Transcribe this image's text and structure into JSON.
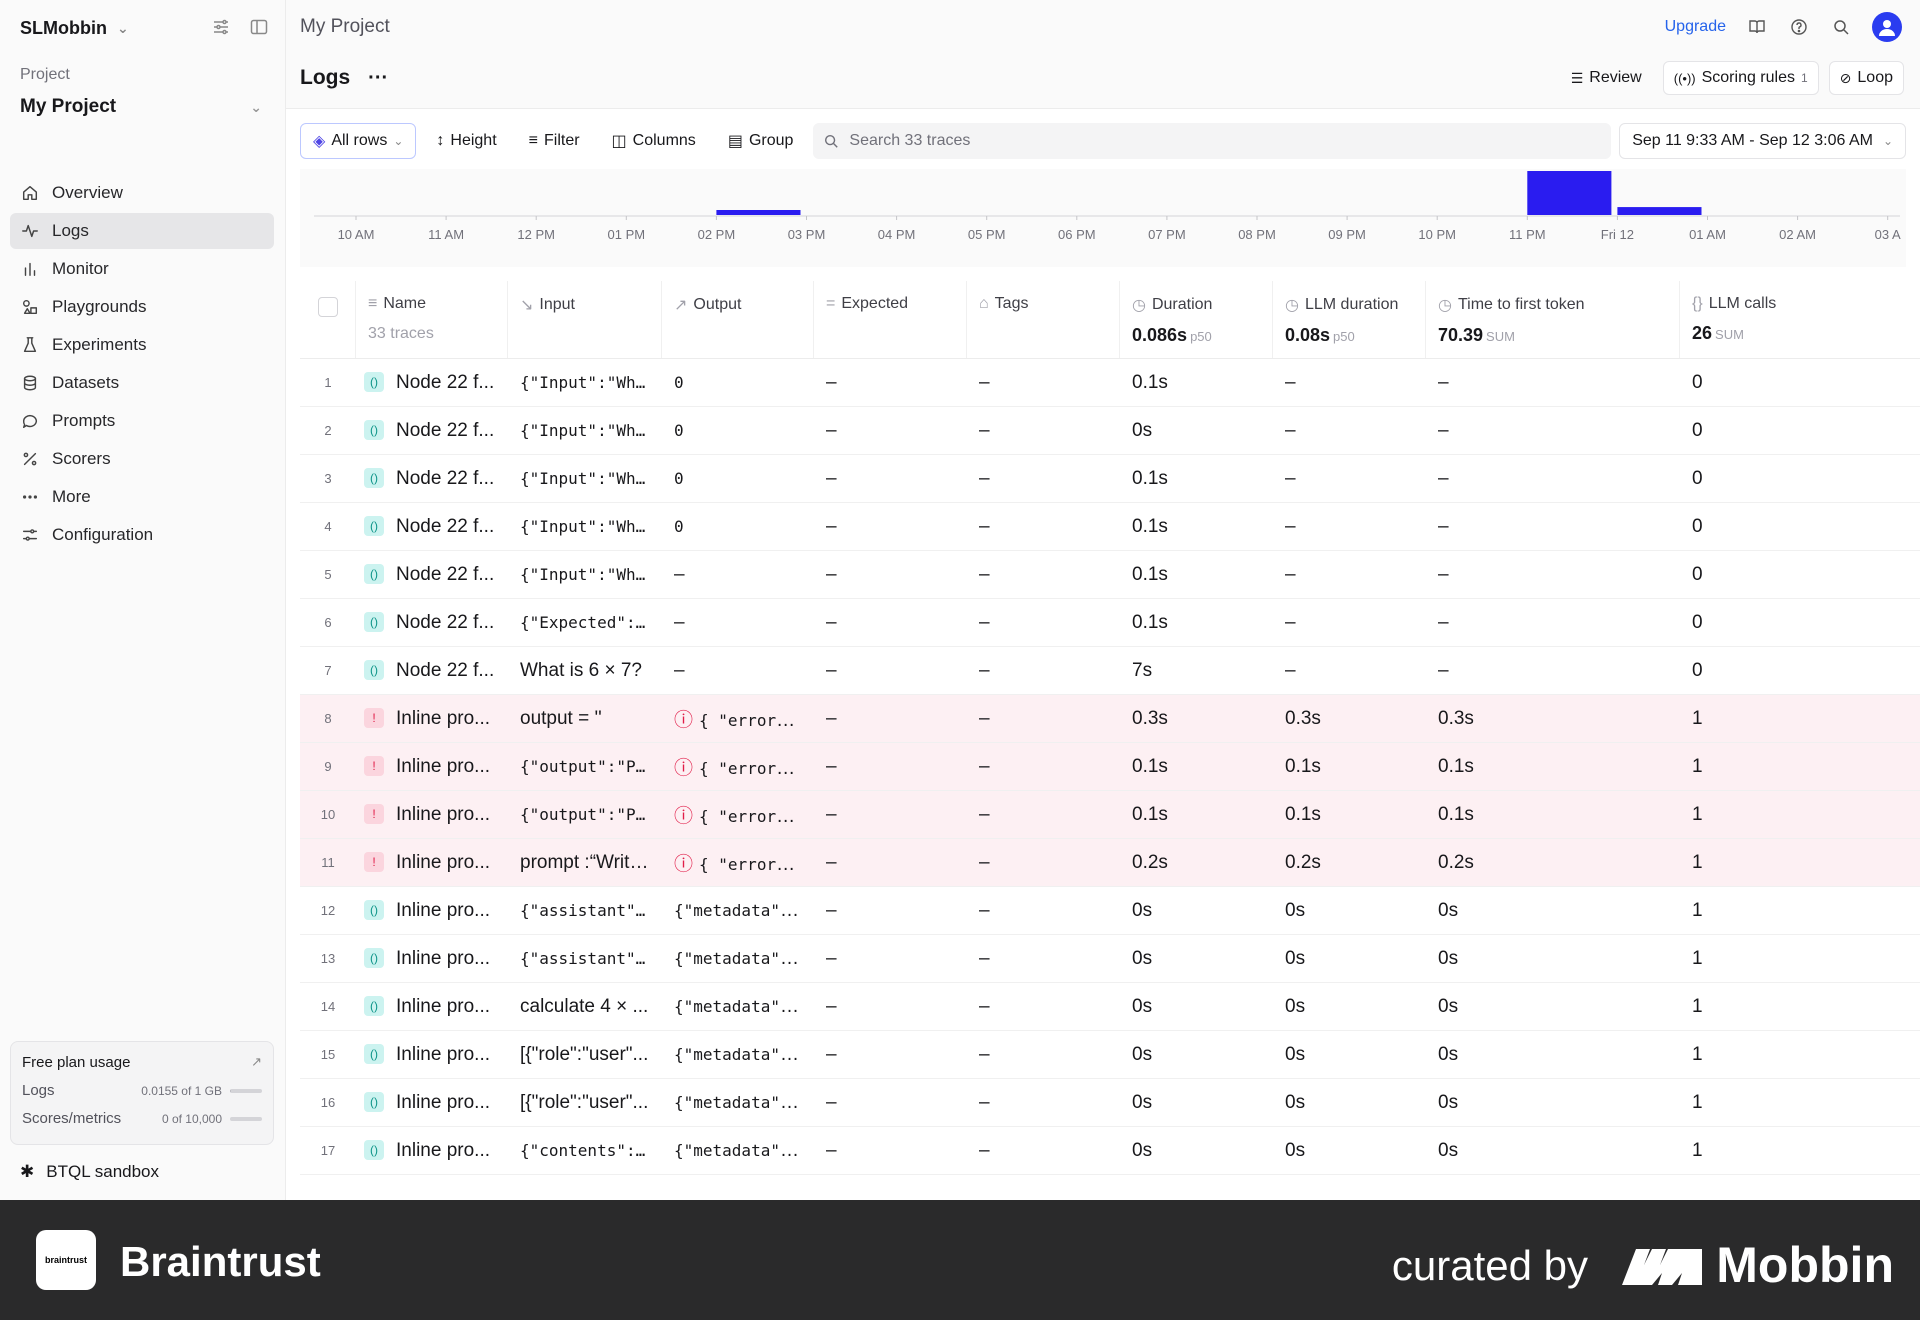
{
  "workspace": {
    "name": "SLMobbin"
  },
  "sidebar": {
    "project_label": "Project",
    "project_name": "My Project",
    "items": [
      {
        "label": "Overview",
        "icon": "home-icon",
        "active": false
      },
      {
        "label": "Logs",
        "icon": "activity-icon",
        "active": true
      },
      {
        "label": "Monitor",
        "icon": "bar-chart-icon",
        "active": false
      },
      {
        "label": "Playgrounds",
        "icon": "shapes-icon",
        "active": false
      },
      {
        "label": "Experiments",
        "icon": "flask-icon",
        "active": false
      },
      {
        "label": "Datasets",
        "icon": "database-icon",
        "active": false
      },
      {
        "label": "Prompts",
        "icon": "message-icon",
        "active": false
      },
      {
        "label": "Scorers",
        "icon": "percent-icon",
        "active": false
      },
      {
        "label": "More",
        "icon": "more-horizontal-icon",
        "active": false
      },
      {
        "label": "Configuration",
        "icon": "sliders-icon",
        "active": false
      }
    ],
    "usage": {
      "title": "Free plan usage",
      "logs_label": "Logs",
      "logs_value": "0.0155 of 1 GB",
      "logs_fraction": 0.0155,
      "scores_label": "Scores/metrics",
      "scores_value": "0 of 10,000",
      "scores_fraction": 0
    },
    "btql": "BTQL sandbox"
  },
  "topbar": {
    "breadcrumb": "My Project",
    "upgrade": "Upgrade"
  },
  "header": {
    "title": "Logs",
    "review": "Review",
    "scoring_rules": "Scoring rules",
    "scoring_rules_count": "1",
    "loop": "Loop"
  },
  "toolbar": {
    "all_rows": "All rows",
    "height": "Height",
    "filter": "Filter",
    "columns": "Columns",
    "group": "Group",
    "search_placeholder": "Search 33 traces",
    "date_range": "Sep 11 9:33 AM - Sep 12 3:06 AM"
  },
  "histogram": {
    "ticks": [
      "10 AM",
      "11 AM",
      "12 PM",
      "01 PM",
      "02 PM",
      "03 PM",
      "04 PM",
      "05 PM",
      "06 PM",
      "07 PM",
      "08 PM",
      "09 PM",
      "10 PM",
      "11 PM",
      "Fri 12",
      "01 AM",
      "02 AM",
      "03 A"
    ],
    "bars": [
      {
        "from_tick": 4,
        "to_tick": 5,
        "level": 0.1
      },
      {
        "from_tick": 13,
        "to_tick": 14,
        "level": 1.0
      },
      {
        "from_tick": 14,
        "to_tick": 15,
        "level": 0.18
      }
    ],
    "bar_color": "#2a1cf0"
  },
  "table": {
    "columns": {
      "name": "Name",
      "name_sub": "33 traces",
      "input": "Input",
      "output": "Output",
      "expected": "Expected",
      "tags": "Tags",
      "duration": "Duration",
      "duration_stat": "0.086s",
      "duration_unit": "p50",
      "llm_duration": "LLM duration",
      "llm_duration_stat": "0.08s",
      "llm_duration_unit": "p50",
      "ttft": "Time to first token",
      "ttft_stat": "70.39",
      "ttft_unit": "SUM",
      "llm_calls": "LLM calls",
      "llm_calls_stat": "26",
      "llm_calls_unit": "SUM"
    },
    "rows": [
      {
        "n": "1",
        "name": "Node 22 f...",
        "input": "{\"Input\":\"Wha...",
        "input_mono": true,
        "output": "0",
        "output_mono": true,
        "expected": "–",
        "tags": "–",
        "duration": "0.1s",
        "llm": "–",
        "ttft": "–",
        "calls": "0",
        "error": false
      },
      {
        "n": "2",
        "name": "Node 22 f...",
        "input": "{\"Input\":\"Wha...",
        "input_mono": true,
        "output": "0",
        "output_mono": true,
        "expected": "–",
        "tags": "–",
        "duration": "0s",
        "llm": "–",
        "ttft": "–",
        "calls": "0",
        "error": false
      },
      {
        "n": "3",
        "name": "Node 22 f...",
        "input": "{\"Input\":\"Wha...",
        "input_mono": true,
        "output": "0",
        "output_mono": true,
        "expected": "–",
        "tags": "–",
        "duration": "0.1s",
        "llm": "–",
        "ttft": "–",
        "calls": "0",
        "error": false
      },
      {
        "n": "4",
        "name": "Node 22 f...",
        "input": "{\"Input\":\"Wha...",
        "input_mono": true,
        "output": "0",
        "output_mono": true,
        "expected": "–",
        "tags": "–",
        "duration": "0.1s",
        "llm": "–",
        "ttft": "–",
        "calls": "0",
        "error": false
      },
      {
        "n": "5",
        "name": "Node 22 f...",
        "input": "{\"Input\":\"Wha...",
        "input_mono": true,
        "output": "–",
        "output_mono": false,
        "expected": "–",
        "tags": "–",
        "duration": "0.1s",
        "llm": "–",
        "ttft": "–",
        "calls": "0",
        "error": false
      },
      {
        "n": "6",
        "name": "Node 22 f...",
        "input": "{\"Expected\":4...",
        "input_mono": true,
        "output": "–",
        "output_mono": false,
        "expected": "–",
        "tags": "–",
        "duration": "0.1s",
        "llm": "–",
        "ttft": "–",
        "calls": "0",
        "error": false
      },
      {
        "n": "7",
        "name": "Node 22 f...",
        "input": "What is 6 × 7?",
        "input_mono": false,
        "output": "–",
        "output_mono": false,
        "expected": "–",
        "tags": "–",
        "duration": "7s",
        "llm": "–",
        "ttft": "–",
        "calls": "0",
        "error": false
      },
      {
        "n": "8",
        "name": "Inline pro...",
        "input": "output = ''",
        "input_mono": false,
        "output": "{ \"error\":...",
        "output_mono": true,
        "expected": "–",
        "tags": "–",
        "duration": "0.3s",
        "llm": "0.3s",
        "ttft": "0.3s",
        "calls": "1",
        "error": true
      },
      {
        "n": "9",
        "name": "Inline pro...",
        "input": "{\"output\":\"Po...",
        "input_mono": true,
        "output": "{ \"error\":...",
        "output_mono": true,
        "expected": "–",
        "tags": "–",
        "duration": "0.1s",
        "llm": "0.1s",
        "ttft": "0.1s",
        "calls": "1",
        "error": true
      },
      {
        "n": "10",
        "name": "Inline pro...",
        "input": "{\"output\":\"Po...",
        "input_mono": true,
        "output": "{ \"error\":...",
        "output_mono": true,
        "expected": "–",
        "tags": "–",
        "duration": "0.1s",
        "llm": "0.1s",
        "ttft": "0.1s",
        "calls": "1",
        "error": true
      },
      {
        "n": "11",
        "name": "Inline pro...",
        "input": "prompt :“Write...",
        "input_mono": false,
        "output": "{ \"error\":...",
        "output_mono": true,
        "expected": "–",
        "tags": "–",
        "duration": "0.2s",
        "llm": "0.2s",
        "ttft": "0.2s",
        "calls": "1",
        "error": true
      },
      {
        "n": "12",
        "name": "Inline pro...",
        "input": "{\"assistant\":...",
        "input_mono": true,
        "output": "{\"metadata\":{...",
        "output_mono": true,
        "expected": "–",
        "tags": "–",
        "duration": "0s",
        "llm": "0s",
        "ttft": "0s",
        "calls": "1",
        "error": false
      },
      {
        "n": "13",
        "name": "Inline pro...",
        "input": "{\"assistant\":...",
        "input_mono": true,
        "output": "{\"metadata\":{...",
        "output_mono": true,
        "expected": "–",
        "tags": "–",
        "duration": "0s",
        "llm": "0s",
        "ttft": "0s",
        "calls": "1",
        "error": false
      },
      {
        "n": "14",
        "name": "Inline pro...",
        "input": "calculate 4 × ...",
        "input_mono": false,
        "output": "{\"metadata\":{...",
        "output_mono": true,
        "expected": "–",
        "tags": "–",
        "duration": "0s",
        "llm": "0s",
        "ttft": "0s",
        "calls": "1",
        "error": false
      },
      {
        "n": "15",
        "name": "Inline pro...",
        "input": "[{\"role\":\"user\"...",
        "input_mono": false,
        "output": "{\"metadata\":{...",
        "output_mono": true,
        "expected": "–",
        "tags": "–",
        "duration": "0s",
        "llm": "0s",
        "ttft": "0s",
        "calls": "1",
        "error": false
      },
      {
        "n": "16",
        "name": "Inline pro...",
        "input": "[{\"role\":\"user\"...",
        "input_mono": false,
        "output": "{\"metadata\":{...",
        "output_mono": true,
        "expected": "–",
        "tags": "–",
        "duration": "0s",
        "llm": "0s",
        "ttft": "0s",
        "calls": "1",
        "error": false
      },
      {
        "n": "17",
        "name": "Inline pro...",
        "input": "{\"contents\":[...",
        "input_mono": true,
        "output": "{\"metadata\":{...",
        "output_mono": true,
        "expected": "–",
        "tags": "–",
        "duration": "0s",
        "llm": "0s",
        "ttft": "0s",
        "calls": "1",
        "error": false
      }
    ]
  },
  "footer": {
    "brand": "Braintrust",
    "logo_text": "braintrust",
    "curated": "curated by",
    "mobbin": "Mobbin"
  }
}
